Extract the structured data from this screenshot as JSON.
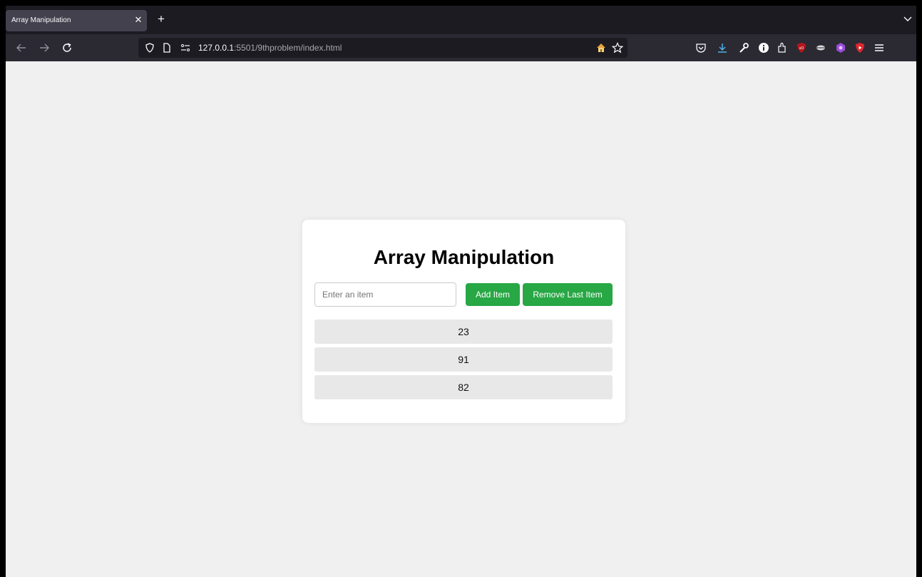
{
  "browser": {
    "tab_title": "Array Manipulation",
    "url_host": "127.0.0.1",
    "url_rest": ":5501/9thproblem/index.html"
  },
  "page": {
    "heading": "Array Manipulation",
    "input_placeholder": "Enter an item",
    "input_value": "",
    "add_label": "Add Item",
    "remove_label": "Remove Last Item",
    "items": [
      "23",
      "91",
      "82"
    ],
    "accent_color": "#28a745",
    "background_color": "#f0f0f0"
  }
}
